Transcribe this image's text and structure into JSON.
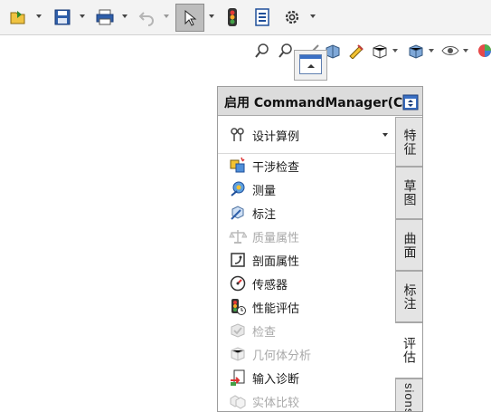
{
  "toolbar": {
    "buttons": [
      {
        "icon": "open-file-icon",
        "has_dropdown": true
      },
      {
        "icon": "save-icon",
        "has_dropdown": true
      },
      {
        "icon": "print-icon",
        "has_dropdown": true
      },
      {
        "icon": "undo-icon",
        "has_dropdown": true,
        "disabled": true
      },
      {
        "icon": "select-arrow-icon",
        "has_dropdown": true,
        "active": true
      },
      {
        "icon": "traffic-light-icon",
        "has_dropdown": false
      },
      {
        "icon": "file-properties-icon",
        "has_dropdown": false
      },
      {
        "icon": "gear-icon",
        "has_dropdown": true
      }
    ]
  },
  "heads_up_toolbar": {
    "icons": [
      "zoom-to-fit-icon",
      "zoom-area-icon",
      "previous-view-icon",
      "section-view-icon",
      "view-dynamic-annotation-icon",
      "view-orientation-icon",
      "display-style-icon",
      "hide-show-items-icon",
      "edit-appearance-icon"
    ]
  },
  "commandmanager": {
    "title": "启用 CommandManager(C)",
    "items": [
      {
        "label": "设计算例",
        "icon": "design-study-icon",
        "enabled": true,
        "dropdown": true
      },
      {
        "label": "干涉检查",
        "icon": "interference-check-icon",
        "enabled": true
      },
      {
        "label": "测量",
        "icon": "measure-icon",
        "enabled": true
      },
      {
        "label": "标注",
        "icon": "markup-icon",
        "enabled": true
      },
      {
        "label": "质量属性",
        "icon": "mass-properties-icon",
        "enabled": false
      },
      {
        "label": "剖面属性",
        "icon": "section-properties-icon",
        "enabled": true
      },
      {
        "label": "传感器",
        "icon": "sensor-icon",
        "enabled": true
      },
      {
        "label": "性能评估",
        "icon": "performance-evaluation-icon",
        "enabled": true
      },
      {
        "label": "检查",
        "icon": "check-icon",
        "enabled": false
      },
      {
        "label": "几何体分析",
        "icon": "geometry-analysis-icon",
        "enabled": false
      },
      {
        "label": "输入诊断",
        "icon": "import-diagnostics-icon",
        "enabled": true
      },
      {
        "label": "实体比较",
        "icon": "compare-bodies-icon",
        "enabled": false
      }
    ],
    "tabs": [
      {
        "label": "特征",
        "active": false
      },
      {
        "label": "草图",
        "active": false
      },
      {
        "label": "曲面",
        "active": false
      },
      {
        "label": "标注",
        "active": false
      },
      {
        "label": "评估",
        "active": true
      },
      {
        "label": "sions",
        "active": false
      }
    ]
  },
  "colors": {
    "toolbar_bg": "#f3f3f3",
    "panel_header_bg": "#dcdcdc",
    "accent_blue": "#3a6fc4",
    "disabled_text": "#a9a9a9"
  }
}
